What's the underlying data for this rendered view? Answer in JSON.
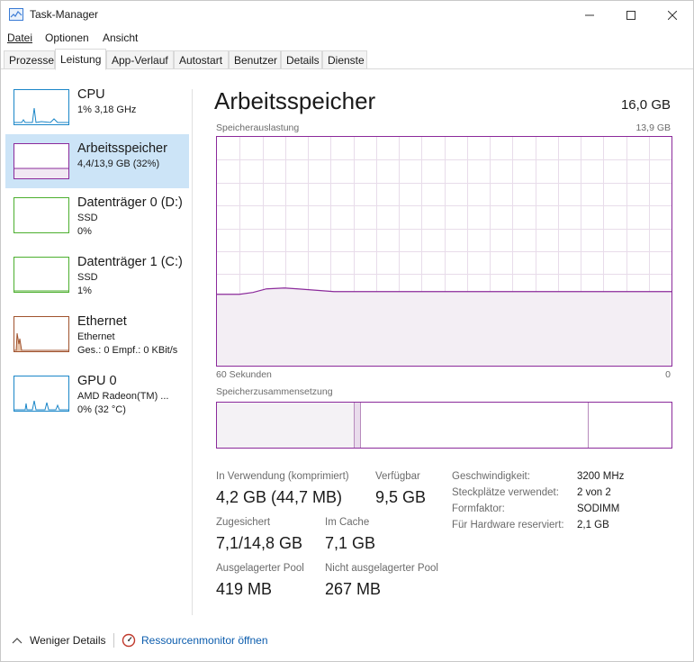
{
  "window": {
    "title": "Task-Manager"
  },
  "menu": [
    "Datei",
    "Optionen",
    "Ansicht"
  ],
  "tabs": [
    "Prozesse",
    "Leistung",
    "App-Verlauf",
    "Autostart",
    "Benutzer",
    "Details",
    "Dienste"
  ],
  "active_tab": "Leistung",
  "resources": [
    {
      "name": "CPU",
      "line1": "1% 3,18 GHz",
      "line2": "",
      "color": "#1a86c8"
    },
    {
      "name": "Arbeitsspeicher",
      "line1": "4,4/13,9 GB (32%)",
      "line2": "",
      "color": "#8b2a9b"
    },
    {
      "name": "Datenträger 0 (D:)",
      "line1": "SSD",
      "line2": "0%",
      "color": "#4caf2e"
    },
    {
      "name": "Datenträger 1 (C:)",
      "line1": "SSD",
      "line2": "1%",
      "color": "#4caf2e"
    },
    {
      "name": "Ethernet",
      "line1": "Ethernet",
      "line2": "Ges.: 0 Empf.: 0 KBit/s",
      "color": "#a0522d"
    },
    {
      "name": "GPU 0",
      "line1": "AMD Radeon(TM) ...",
      "line2": "0% (32 °C)",
      "color": "#1a86c8"
    }
  ],
  "detail": {
    "title": "Arbeitsspeicher",
    "total": "16,0 GB",
    "usage_label": "Speicherauslastung",
    "usage_max": "13,9 GB",
    "time_left": "60 Sekunden",
    "time_right": "0",
    "composition_label": "Speicherzusammensetzung",
    "memory_usage_fraction": 0.32,
    "stats": {
      "in_use_label": "In Verwendung (komprimiert)",
      "in_use_value": "4,2 GB (44,7 MB)",
      "available_label": "Verfügbar",
      "available_value": "9,5 GB",
      "committed_label": "Zugesichert",
      "committed_value": "7,1/14,8 GB",
      "cached_label": "Im Cache",
      "cached_value": "7,1 GB",
      "paged_label": "Ausgelagerter Pool",
      "paged_value": "419 MB",
      "nonpaged_label": "Nicht ausgelagerter Pool",
      "nonpaged_value": "267 MB"
    },
    "kv": [
      {
        "key": "Geschwindigkeit:",
        "value": "3200 MHz"
      },
      {
        "key": "Steckplätze verwendet:",
        "value": "2 von 2"
      },
      {
        "key": "Formfaktor:",
        "value": "SODIMM"
      },
      {
        "key": "Für Hardware reserviert:",
        "value": "2,1 GB"
      }
    ]
  },
  "footer": {
    "fewer_details": "Weniger Details",
    "resource_monitor": "Ressourcenmonitor öffnen"
  }
}
